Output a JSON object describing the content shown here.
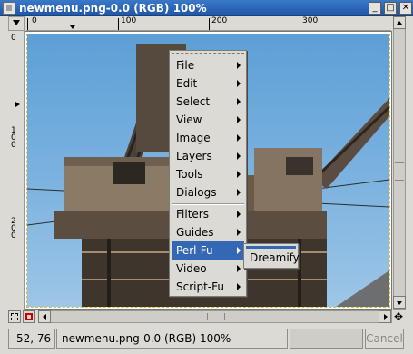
{
  "window": {
    "title": "newmenu.png-0.0 (RGB) 100%",
    "buttons": {
      "minimize": "_",
      "maximize": "□",
      "close": "✕"
    }
  },
  "ruler": {
    "h_labels": [
      "0",
      "100",
      "200",
      "300"
    ],
    "v_labels": [
      "0",
      "1\n0\n0",
      "2\n0\n0"
    ]
  },
  "menu": {
    "items": [
      {
        "label": "File"
      },
      {
        "label": "Edit"
      },
      {
        "label": "Select"
      },
      {
        "label": "View"
      },
      {
        "label": "Image"
      },
      {
        "label": "Layers"
      },
      {
        "label": "Tools"
      },
      {
        "label": "Dialogs"
      },
      {
        "label": "Filters"
      },
      {
        "label": "Guides"
      },
      {
        "label": "Perl-Fu"
      },
      {
        "label": "Video"
      },
      {
        "label": "Script-Fu"
      }
    ],
    "active_item": "Perl-Fu",
    "submenu_items": [
      {
        "label": "Dreamify"
      }
    ]
  },
  "status": {
    "coords": "52, 76",
    "title": "newmenu.png-0.0 (RGB) 100%",
    "cancel_label": "Cancel"
  },
  "colors": {
    "titlebar": "#1f56a8",
    "menu_highlight": "#3568b4",
    "sky": "#7db3e0",
    "rust": "#6b5a48"
  },
  "icons": [
    "quickmask-icon",
    "nav-crosshair-icon",
    "window-app-icon",
    "ruler-corner-arrow-icon"
  ]
}
